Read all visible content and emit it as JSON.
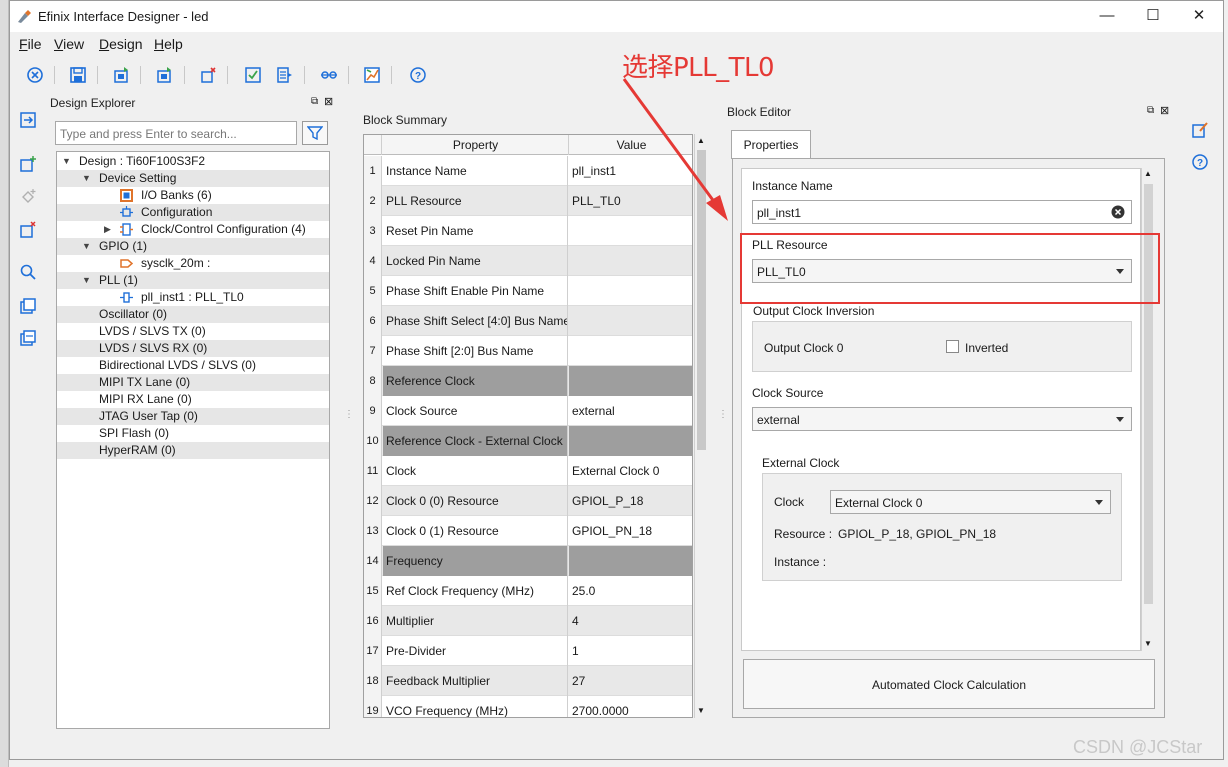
{
  "window": {
    "title": "Efinix Interface Designer - led",
    "minimize": "—",
    "maximize": "☐",
    "close": "✕"
  },
  "menu": [
    {
      "label": "File"
    },
    {
      "label": "View"
    },
    {
      "label": "Design"
    },
    {
      "label": "Help"
    }
  ],
  "design_explorer": {
    "title": "Design Explorer",
    "search_placeholder": "Type and press Enter to search...",
    "tree": [
      {
        "label": "Design : Ti60F100S3F2",
        "expanded": true
      },
      {
        "label": "Device Setting",
        "expanded": true
      },
      {
        "label": "I/O Banks (6)"
      },
      {
        "label": "Configuration"
      },
      {
        "label": "Clock/Control Configuration (4)",
        "expanded": false
      },
      {
        "label": "GPIO (1)",
        "expanded": true
      },
      {
        "label": "sysclk_20m :"
      },
      {
        "label": "PLL (1)",
        "expanded": true
      },
      {
        "label": "pll_inst1 : PLL_TL0"
      },
      {
        "label": "Oscillator (0)"
      },
      {
        "label": "LVDS / SLVS TX (0)"
      },
      {
        "label": "LVDS / SLVS RX (0)"
      },
      {
        "label": "Bidirectional LVDS / SLVS (0)"
      },
      {
        "label": "MIPI TX Lane (0)"
      },
      {
        "label": "MIPI RX Lane (0)"
      },
      {
        "label": "JTAG User Tap (0)"
      },
      {
        "label": "SPI Flash (0)"
      },
      {
        "label": "HyperRAM (0)"
      }
    ]
  },
  "block_summary": {
    "title": "Block Summary",
    "col_property": "Property",
    "col_value": "Value",
    "rows": [
      {
        "n": "1",
        "property": "Instance Name",
        "value": "pll_inst1"
      },
      {
        "n": "2",
        "property": "PLL Resource",
        "value": "PLL_TL0"
      },
      {
        "n": "3",
        "property": "Reset Pin Name",
        "value": ""
      },
      {
        "n": "4",
        "property": "Locked Pin Name",
        "value": ""
      },
      {
        "n": "5",
        "property": "Phase Shift Enable Pin Name",
        "value": ""
      },
      {
        "n": "6",
        "property": "Phase Shift Select [4:0] Bus Name",
        "value": ""
      },
      {
        "n": "7",
        "property": "Phase Shift [2:0] Bus Name",
        "value": ""
      },
      {
        "n": "8",
        "property": "Reference Clock",
        "value": ""
      },
      {
        "n": "9",
        "property": "Clock Source",
        "value": "external"
      },
      {
        "n": "10",
        "property": "Reference Clock - External Clock",
        "value": ""
      },
      {
        "n": "11",
        "property": "Clock",
        "value": "External Clock 0"
      },
      {
        "n": "12",
        "property": "Clock 0 (0) Resource",
        "value": "GPIOL_P_18"
      },
      {
        "n": "13",
        "property": "Clock 0 (1) Resource",
        "value": "GPIOL_PN_18"
      },
      {
        "n": "14",
        "property": "Frequency",
        "value": ""
      },
      {
        "n": "15",
        "property": "Ref Clock Frequency (MHz)",
        "value": "25.0"
      },
      {
        "n": "16",
        "property": "Multiplier",
        "value": "4"
      },
      {
        "n": "17",
        "property": "Pre-Divider",
        "value": "1"
      },
      {
        "n": "18",
        "property": "Feedback Multiplier",
        "value": "27"
      },
      {
        "n": "19",
        "property": "VCO Frequency (MHz)",
        "value": "2700.0000"
      }
    ]
  },
  "block_editor": {
    "title": "Block Editor",
    "tab": "Properties",
    "instance_name_label": "Instance Name",
    "instance_name_value": "pll_inst1",
    "pll_resource_label": "PLL Resource",
    "pll_resource_value": "PLL_TL0",
    "output_clock_inversion_label": "Output Clock Inversion",
    "output_clock_label": "Output Clock 0",
    "inverted_label": "Inverted",
    "clock_source_label": "Clock Source",
    "clock_source_value": "external",
    "external_clock_label": "External Clock",
    "clock_label": "Clock",
    "clock_value": "External Clock 0",
    "resource_label": "Resource :",
    "resource_value": "GPIOL_P_18, GPIOL_PN_18",
    "instance_label": "Instance :",
    "auto_calc_button": "Automated Clock Calculation"
  },
  "annotation": "选择PLL_TL0",
  "watermark": "CSDN @JCStar",
  "colors": {
    "annotation_red": "#e53935",
    "group_row": "#9e9e9e",
    "toolbar_icon_blue": "#1e6fd9"
  }
}
